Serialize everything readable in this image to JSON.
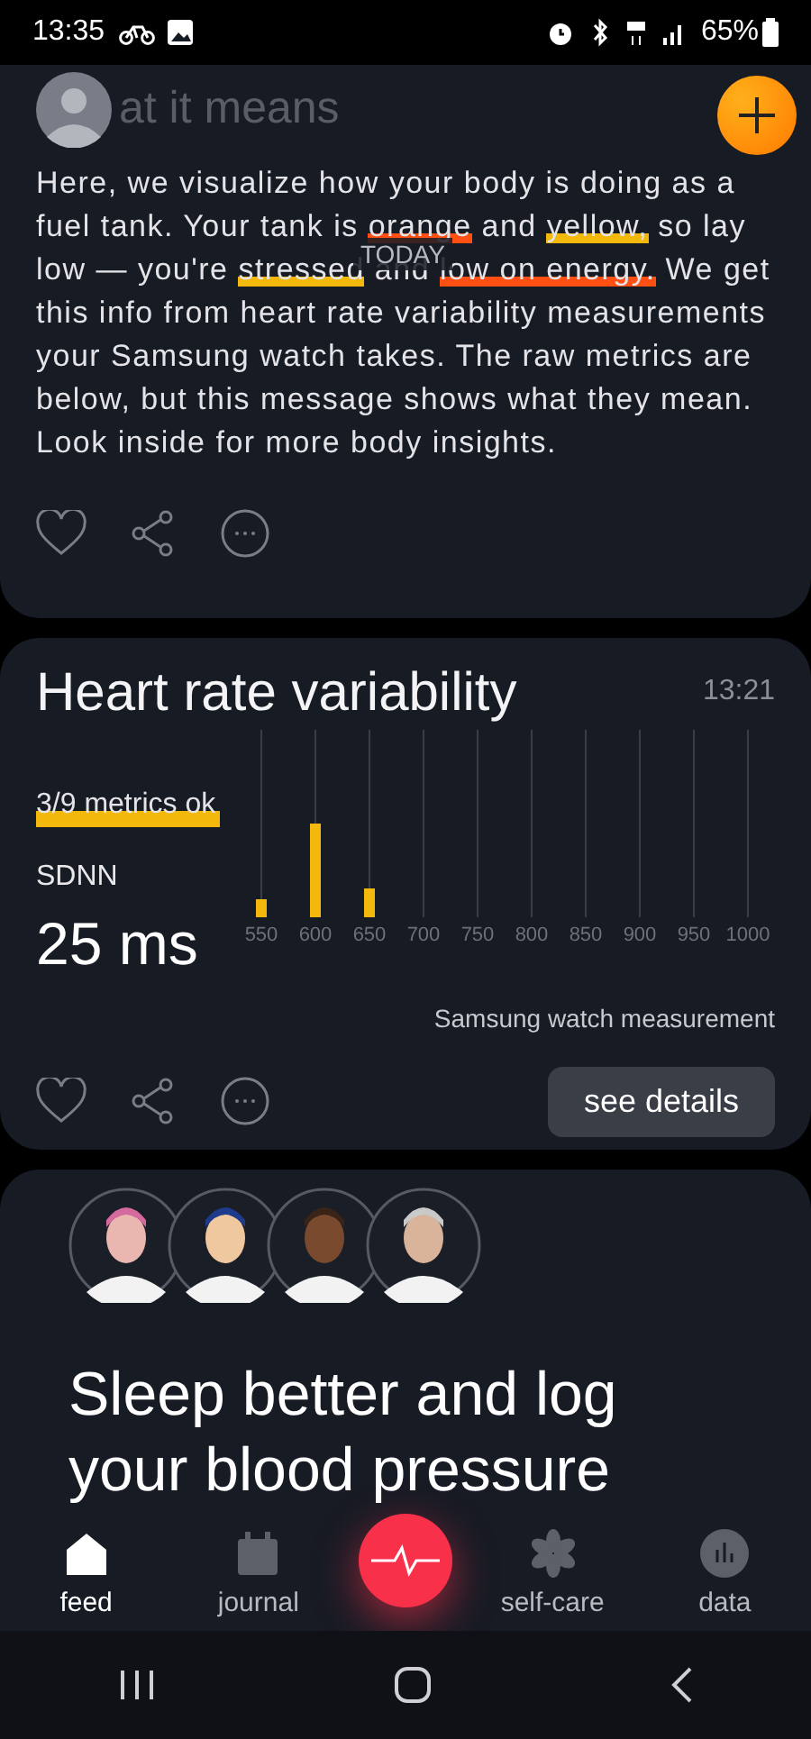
{
  "status_bar": {
    "time": "13:35",
    "battery": "65%"
  },
  "insight_card": {
    "title": "at it means",
    "today": "TODAY",
    "paragraph": [
      {
        "text": "Here, we visualize how your body is doing as a fuel tank. Your tank is "
      },
      {
        "text": "orange",
        "color": "#ff4f12"
      },
      {
        "text": " and "
      },
      {
        "text": "yellow,",
        "color": "#f2b90c"
      },
      {
        "text": " so lay low — you're "
      },
      {
        "text": "stressed",
        "color": "#f2b90c"
      },
      {
        "text": " and "
      },
      {
        "text": "low on energy.",
        "color": "#ff4f12"
      },
      {
        "text": " We get this info from heart rate variability measurements your Samsung watch takes. The raw metrics are below, but this message shows what they mean. Look inside for more body insights."
      }
    ]
  },
  "hrv_card": {
    "title": "Heart rate variability",
    "time": "13:21",
    "metrics": "3/9 metrics ok",
    "metric_name": "SDNN",
    "metric_value": "25 ms",
    "x_labels": [
      "550",
      "600",
      "650",
      "700",
      "750",
      "800",
      "850",
      "900",
      "950",
      "1000"
    ],
    "source": "Samsung watch measurement",
    "details_button": "see details"
  },
  "promo_card": {
    "title": "Sleep better and log your blood pressure"
  },
  "bottom_nav": [
    {
      "label": "feed",
      "selected": true,
      "kind": "home"
    },
    {
      "label": "journal",
      "selected": false,
      "kind": "calendar"
    },
    {
      "kind": "pulse",
      "selected": false
    },
    {
      "label": "self-care",
      "selected": false,
      "kind": "flower"
    },
    {
      "label": "data",
      "selected": false,
      "kind": "chart"
    }
  ]
}
